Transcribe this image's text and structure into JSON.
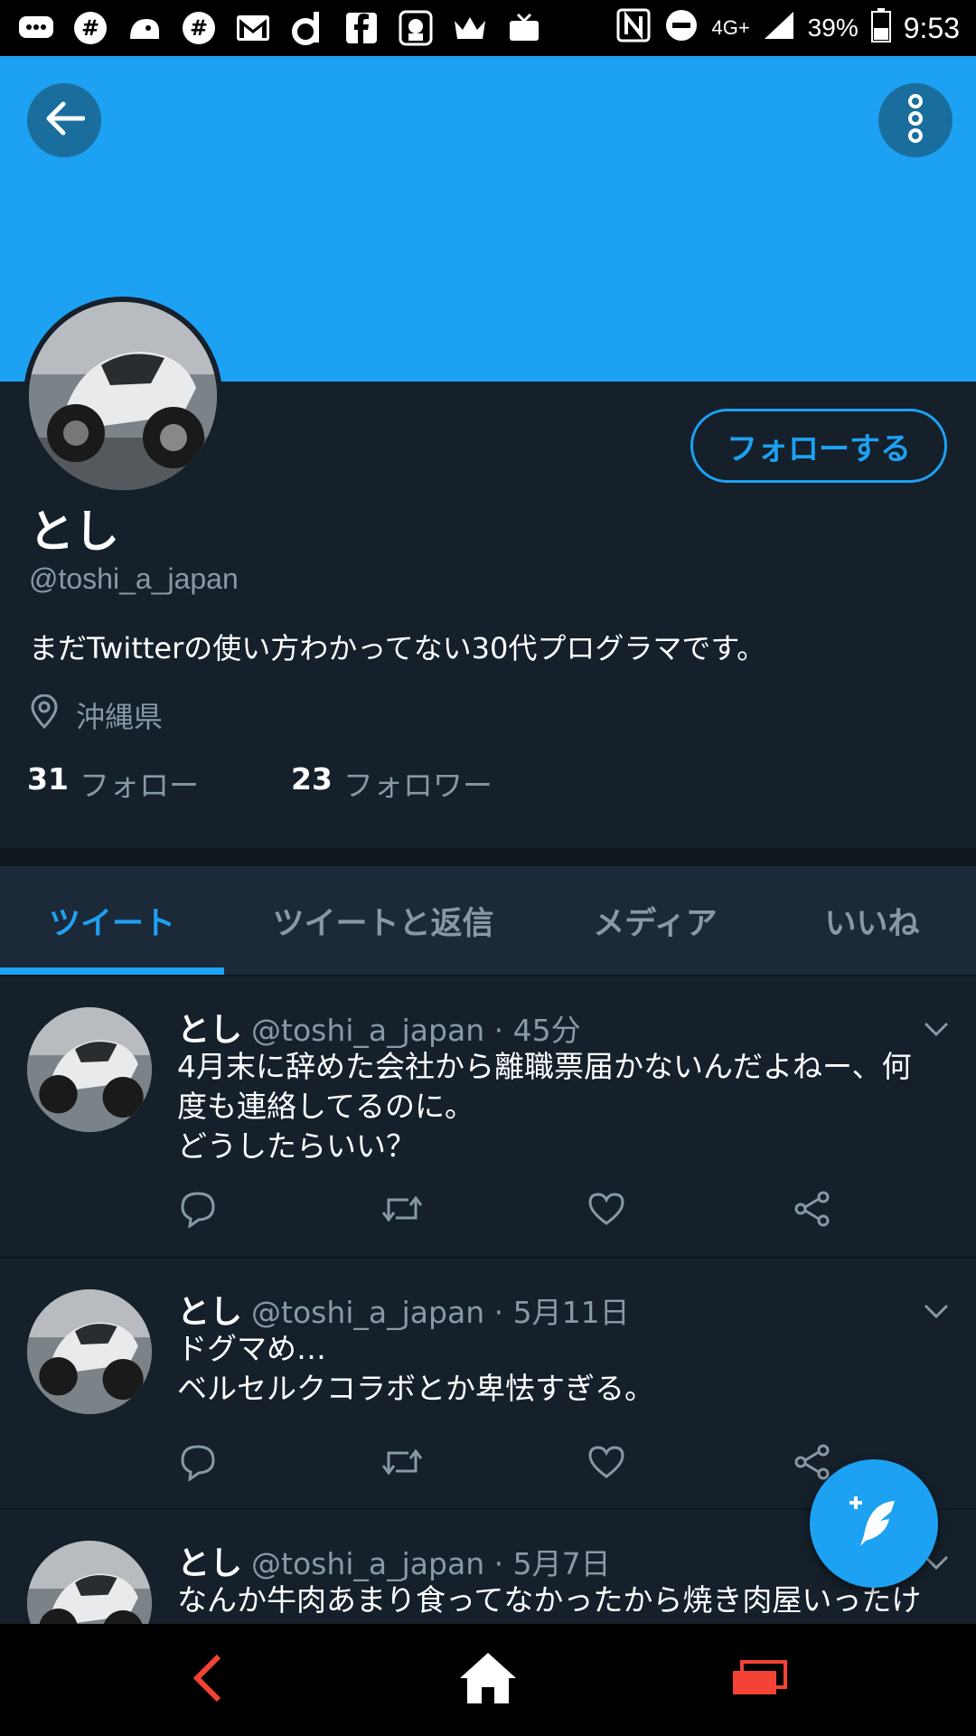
{
  "status_bar": {
    "network": "4G+",
    "battery": "39%",
    "time": "9:53",
    "app_icons": [
      "chat-icon",
      "slack-icon",
      "penguin-icon",
      "slack-icon",
      "gmail-icon",
      "d-icon",
      "facebook-icon",
      "bird-icon",
      "crown-icon",
      "tv-icon"
    ]
  },
  "profile": {
    "name": "とし",
    "handle": "@toshi_a_japan",
    "bio": "まだTwitterの使い方わかってない30代プログラマです。",
    "location": "沖縄県",
    "following_count": "31",
    "following_label": "フォロー",
    "followers_count": "23",
    "followers_label": "フォロワー",
    "follow_button": "フォローする"
  },
  "tabs": [
    {
      "label": "ツイート",
      "active": true
    },
    {
      "label": "ツイートと返信",
      "active": false
    },
    {
      "label": "メディア",
      "active": false
    },
    {
      "label": "いいね",
      "active": false
    }
  ],
  "tweets": [
    {
      "name": "とし",
      "handle": "@toshi_a_japan",
      "time": "· 45分",
      "text": "4月末に辞めた会社から離職票届かないんだよねー、何\n度も連絡してるのに。\nどうしたらいい？"
    },
    {
      "name": "とし",
      "handle": "@toshi_a_japan",
      "time": "· 5月11日",
      "text": "ドグマめ…\nベルセルクコラボとか卑怯すぎる。"
    },
    {
      "name": "とし",
      "handle": "@toshi_a_japan",
      "time": "· 5月7日",
      "text": "なんか牛肉あまり食ってなかったから焼き肉屋いったけ"
    }
  ],
  "colors": {
    "accent": "#1da1f2",
    "background": "#15202b",
    "secondary_text": "#8899a6",
    "nav_accent": "#f44336"
  }
}
